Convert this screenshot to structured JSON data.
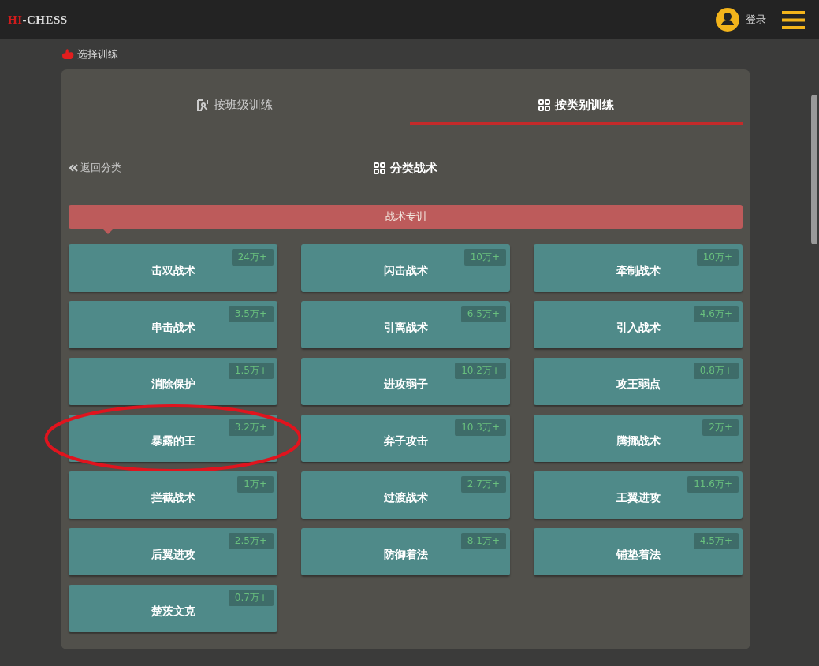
{
  "header": {
    "logo": {
      "accent": "HI",
      "rest": "-CHESS"
    },
    "login": "登录"
  },
  "breadcrumb": "选择训练",
  "tabs": [
    {
      "label": "按班级训练",
      "selected": false
    },
    {
      "label": "按类别训练",
      "selected": true
    }
  ],
  "back": "返回分类",
  "section_title": "分类战术",
  "banner": "战术专训",
  "items": [
    {
      "name": "击双战术",
      "count": "24万+",
      "circled": false
    },
    {
      "name": "闪击战术",
      "count": "10万+",
      "circled": false
    },
    {
      "name": "牵制战术",
      "count": "10万+",
      "circled": false
    },
    {
      "name": "串击战术",
      "count": "3.5万+",
      "circled": false
    },
    {
      "name": "引离战术",
      "count": "6.5万+",
      "circled": false
    },
    {
      "name": "引入战术",
      "count": "4.6万+",
      "circled": false
    },
    {
      "name": "消除保护",
      "count": "1.5万+",
      "circled": false
    },
    {
      "name": "进攻弱子",
      "count": "10.2万+",
      "circled": false
    },
    {
      "name": "攻王弱点",
      "count": "0.8万+",
      "circled": false
    },
    {
      "name": "暴露的王",
      "count": "3.2万+",
      "circled": true
    },
    {
      "name": "弃子攻击",
      "count": "10.3万+",
      "circled": false
    },
    {
      "name": "腾挪战术",
      "count": "2万+",
      "circled": false
    },
    {
      "name": "拦截战术",
      "count": "1万+",
      "circled": false
    },
    {
      "name": "过渡战术",
      "count": "2.7万+",
      "circled": false
    },
    {
      "name": "王翼进攻",
      "count": "11.6万+",
      "circled": false
    },
    {
      "name": "后翼进攻",
      "count": "2.5万+",
      "circled": false
    },
    {
      "name": "防御着法",
      "count": "8.1万+",
      "circled": false
    },
    {
      "name": "铺垫着法",
      "count": "4.5万+",
      "circled": false
    },
    {
      "name": "楚茨文克",
      "count": "0.7万+",
      "circled": false
    }
  ]
}
